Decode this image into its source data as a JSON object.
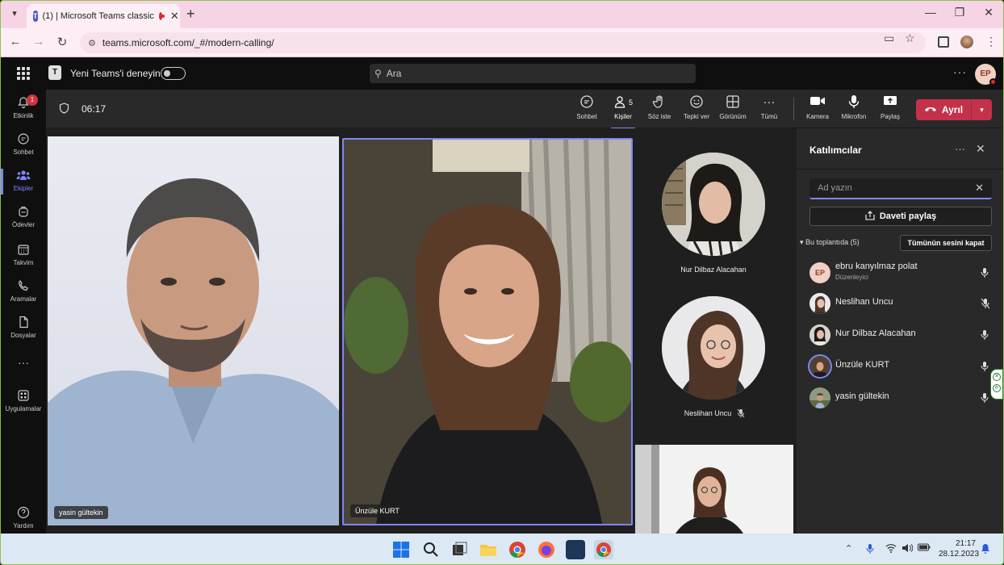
{
  "browser": {
    "tab_title": "(1) | Microsoft Teams classic",
    "url": "teams.microsoft.com/_#/modern-calling/"
  },
  "topbar": {
    "try_new_teams": "Yeni Teams'i deneyin",
    "search_placeholder": "Ara",
    "user_initials": "EP"
  },
  "rail": {
    "items": [
      {
        "label": "Etkinlik",
        "badge": "1"
      },
      {
        "label": "Sohbet"
      },
      {
        "label": "Ekipler"
      },
      {
        "label": "Ödevler"
      },
      {
        "label": "Takvim"
      },
      {
        "label": "Aramalar"
      },
      {
        "label": "Dosyalar"
      },
      {
        "label": "Uygulamalar"
      },
      {
        "label": "Yardım"
      }
    ],
    "more": "···"
  },
  "meeting": {
    "timer": "06:17",
    "toolbar": {
      "chat": "Sohbet",
      "people": "Kişiler",
      "people_count": "5",
      "raise_hand": "Söz iste",
      "react": "Tepki ver",
      "view": "Görünüm",
      "more": "Tümü",
      "camera": "Kamera",
      "mic": "Mikrofon",
      "share": "Paylaş",
      "leave": "Ayrıl"
    },
    "tiles": {
      "t1": "yasin gültekin",
      "t2": "Ünzüle KURT",
      "c1": "Nur Dilbaz Alacahan",
      "c2": "Neslihan Uncu"
    }
  },
  "panel": {
    "title": "Katılımcılar",
    "name_placeholder": "Ad yazın",
    "share_invite": "Daveti paylaş",
    "section": "Bu toplantıda (5)",
    "mute_all": "Tümünün sesini kapat",
    "participants": [
      {
        "name": "ebru kanyılmaz polat",
        "role": "Düzenleyici",
        "initials": "EP"
      },
      {
        "name": "Neslihan Uncu"
      },
      {
        "name": "Nur Dilbaz Alacahan"
      },
      {
        "name": "Ünzüle KURT"
      },
      {
        "name": "yasin gültekin"
      }
    ]
  },
  "taskbar": {
    "time": "21:17",
    "date": "28.12.2023"
  }
}
